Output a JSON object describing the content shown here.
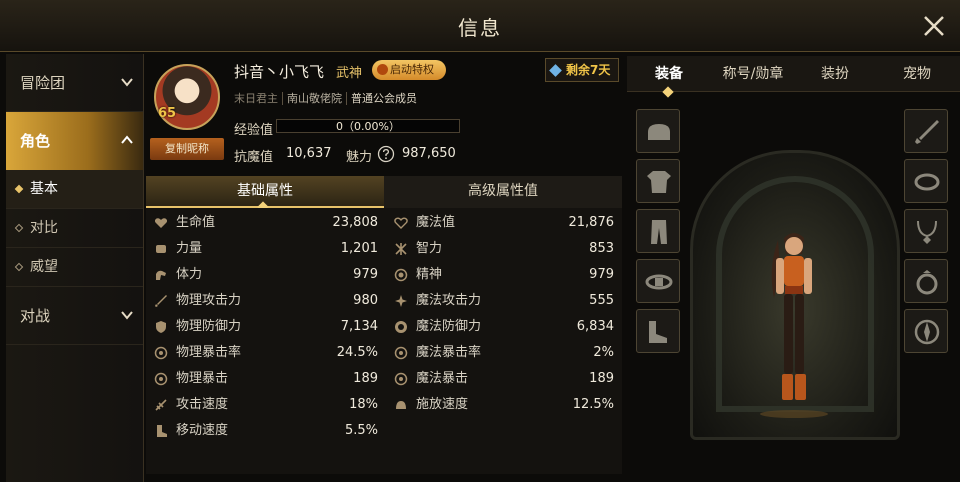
{
  "header": {
    "title": "信息"
  },
  "sidebar": {
    "sections": [
      {
        "label": "冒险团"
      },
      {
        "label": "角色"
      },
      {
        "label": "对战"
      }
    ],
    "sub_items": [
      {
        "label": "基本"
      },
      {
        "label": "对比"
      },
      {
        "label": "威望"
      }
    ]
  },
  "profile": {
    "name": "抖音丶小飞飞",
    "job": "武神",
    "privilege_button": "启动特权",
    "remain": "剩余7天",
    "tags": [
      "末日君主",
      "南山敬佬院",
      "普通公会成员"
    ],
    "level": "65",
    "copy_button": "复制昵称",
    "exp_label": "经验值",
    "exp_value": "0（0.00%）",
    "exp_fraction": 0,
    "kangmo_label": "抗魔值",
    "kangmo_value": "10,637",
    "charm_label": "魅力",
    "charm_value": "987,650"
  },
  "attr_tabs": [
    "基础属性",
    "高级属性值"
  ],
  "attributes_left": [
    {
      "icon": "heart-icon",
      "label": "生命值",
      "value": "23,808"
    },
    {
      "icon": "fist-icon",
      "label": "力量",
      "value": "1,201"
    },
    {
      "icon": "arm-icon",
      "label": "体力",
      "value": "979"
    },
    {
      "icon": "sword-icon",
      "label": "物理攻击力",
      "value": "980"
    },
    {
      "icon": "shield-icon",
      "label": "物理防御力",
      "value": "7,134"
    },
    {
      "icon": "crosshair-icon",
      "label": "物理暴击率",
      "value": "24.5%"
    },
    {
      "icon": "crosshair-icon",
      "label": "物理暴击",
      "value": "189"
    },
    {
      "icon": "speed-icon",
      "label": "攻击速度",
      "value": "18%"
    },
    {
      "icon": "boot-icon",
      "label": "移动速度",
      "value": "5.5%"
    }
  ],
  "attributes_right": [
    {
      "icon": "heart-outline-icon",
      "label": "魔法值",
      "value": "21,876"
    },
    {
      "icon": "brain-icon",
      "label": "智力",
      "value": "853"
    },
    {
      "icon": "spirit-icon",
      "label": "精神",
      "value": "979"
    },
    {
      "icon": "magic-attack-icon",
      "label": "魔法攻击力",
      "value": "555"
    },
    {
      "icon": "magic-defense-icon",
      "label": "魔法防御力",
      "value": "6,834"
    },
    {
      "icon": "target-icon",
      "label": "魔法暴击率",
      "value": "2%"
    },
    {
      "icon": "target-icon",
      "label": "魔法暴击",
      "value": "189"
    },
    {
      "icon": "cast-icon",
      "label": "施放速度",
      "value": "12.5%"
    }
  ],
  "equip_tabs": [
    "装备",
    "称号/勋章",
    "装扮",
    "宠物"
  ],
  "colors": {
    "accent": "#e8c36a",
    "active_tab": "#d9a63a",
    "panel": "#14120f",
    "background": "#0c0b09"
  }
}
